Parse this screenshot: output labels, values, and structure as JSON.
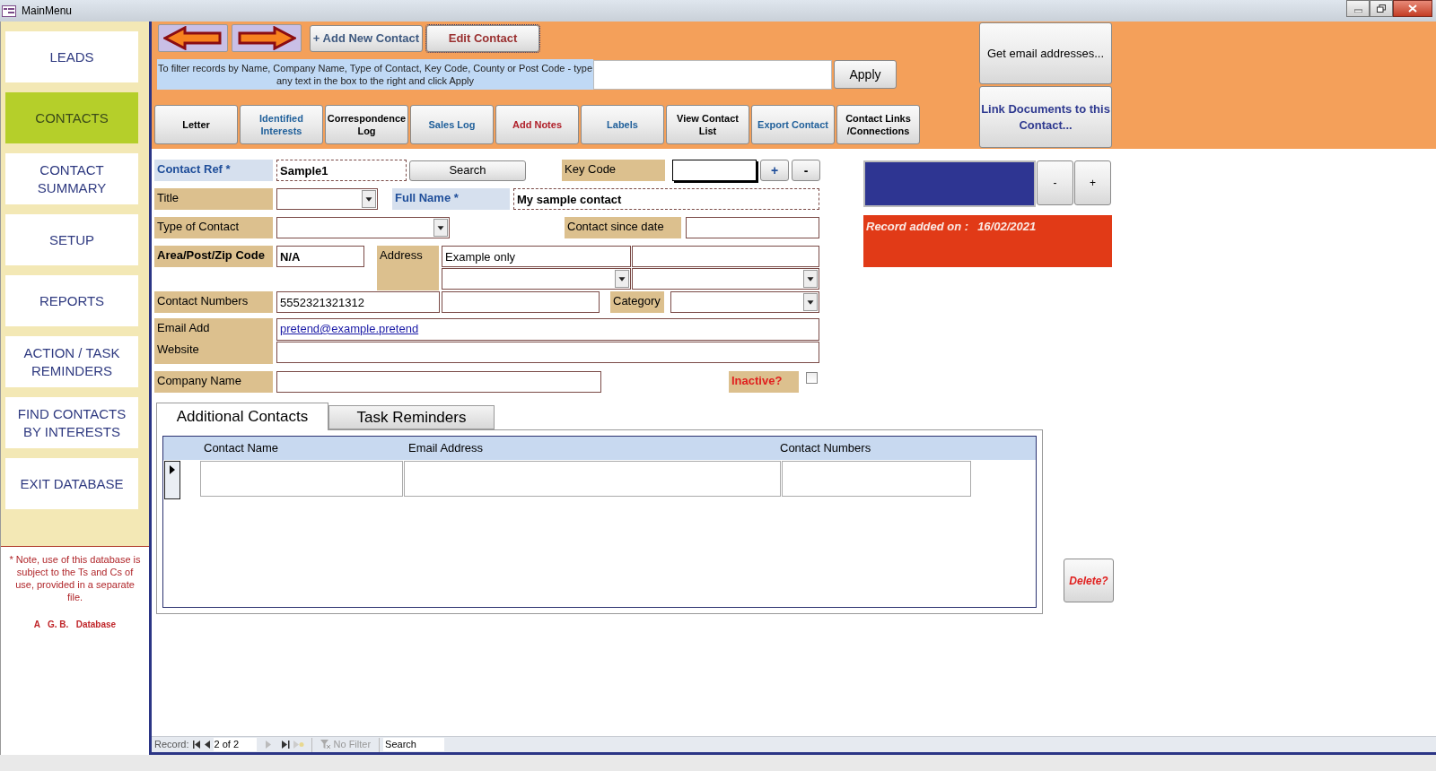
{
  "window": {
    "title": "MainMenu"
  },
  "sidebar": {
    "items": [
      {
        "label": "LEADS",
        "selected": false
      },
      {
        "label": "CONTACTS",
        "selected": true
      },
      {
        "label": "CONTACT SUMMARY",
        "selected": false
      },
      {
        "label": "SETUP",
        "selected": false
      },
      {
        "label": "REPORTS",
        "selected": false
      },
      {
        "label": "ACTION / TASK REMINDERS",
        "selected": false
      },
      {
        "label": "FIND CONTACTS BY INTERESTS",
        "selected": false
      },
      {
        "label": "EXIT DATABASE",
        "selected": false
      }
    ],
    "note": "* Note, use of this database is subject to the Ts and Cs of use, provided in a separate file.",
    "footer": "A   G. B.   Database"
  },
  "header": {
    "add_button": "+ Add New Contact",
    "edit_button": "Edit Contact",
    "filter": {
      "instructions": "To filter records by Name, Company Name, Type of Contact, Key Code, County or Post Code - type any text in the box to the right and click Apply",
      "apply": "Apply"
    },
    "toolbar": [
      {
        "label": "Letter",
        "color": "#000000"
      },
      {
        "label": "Identified Interests",
        "color": "#1f5f9a"
      },
      {
        "label": "Correspondence Log",
        "color": "#000000"
      },
      {
        "label": "Sales Log",
        "color": "#1f5f9a"
      },
      {
        "label": "Add Notes",
        "color": "#b0202a"
      },
      {
        "label": "Labels",
        "color": "#1f5f9a"
      },
      {
        "label": "View Contact List",
        "color": "#000000"
      },
      {
        "label": "Export Contact",
        "color": "#1f5f9a"
      },
      {
        "label": "Contact Links /Connections",
        "color": "#000000"
      }
    ],
    "side_buttons": [
      "Get email addresses...",
      "Link Documents to this Contact..."
    ]
  },
  "form": {
    "contact_ref": {
      "label": "Contact Ref *",
      "value": "Sample1"
    },
    "search_button": "Search",
    "key_code": {
      "label": "Key Code",
      "plus": "+",
      "minus": "-"
    },
    "title": {
      "label": "Title"
    },
    "full_name": {
      "label": "Full Name *",
      "value": "My sample contact"
    },
    "type_of_contact": {
      "label": "Type of Contact"
    },
    "contact_since": {
      "label": "Contact since date"
    },
    "area_code": {
      "label": "Area/Post/Zip Code",
      "value": "N/A"
    },
    "address": {
      "label": "Address",
      "line_1": "Example only"
    },
    "contact_numbers": {
      "label": "Contact Numbers",
      "value": "5552321321312"
    },
    "category": {
      "label": "Category"
    },
    "email": {
      "label": "Email Add",
      "value": "pretend@example.pretend"
    },
    "website": {
      "label": "Website"
    },
    "company_name": {
      "label": "Company Name"
    },
    "inactive": {
      "label": "Inactive?",
      "checked": false
    }
  },
  "record_panel": {
    "minus": "-",
    "plus": "+",
    "added_label": "Record added on :",
    "added_date": "16/02/2021"
  },
  "tabs": [
    {
      "label": "Additional Contacts",
      "selected": true
    },
    {
      "label": "Task Reminders",
      "selected": false
    }
  ],
  "subform": {
    "columns": [
      "Contact Name",
      "Email Address",
      "Contact Numbers"
    ]
  },
  "delete_button": "Delete?",
  "status_bar": {
    "record_label": "Record:",
    "position": "2 of 2",
    "filter": "No Filter",
    "search_placeholder": "Search"
  }
}
